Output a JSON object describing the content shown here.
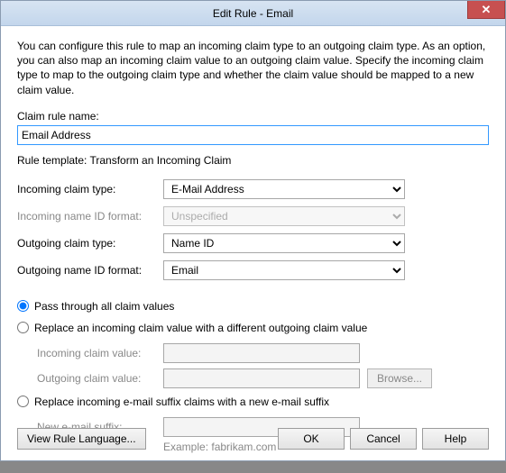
{
  "window": {
    "title": "Edit Rule - Email",
    "close_glyph": "✕"
  },
  "intro": "You can configure this rule to map an incoming claim type to an outgoing claim type. As an option, you can also map an incoming claim value to an outgoing claim value. Specify the incoming claim type to map to the outgoing claim type and whether the claim value should be mapped to a new claim value.",
  "labels": {
    "claim_rule_name": "Claim rule name:",
    "rule_template": "Rule template: Transform an Incoming Claim",
    "incoming_claim_type": "Incoming claim type:",
    "incoming_name_id_format": "Incoming name ID format:",
    "outgoing_claim_type": "Outgoing claim type:",
    "outgoing_name_id_format": "Outgoing name ID format:",
    "incoming_claim_value": "Incoming claim value:",
    "outgoing_claim_value": "Outgoing claim value:",
    "new_email_suffix": "New e-mail suffix:",
    "example_text": "Example: fabrikam.com"
  },
  "values": {
    "claim_rule_name": "Email Address",
    "incoming_claim_type": "E-Mail Address",
    "incoming_name_id_format": "Unspecified",
    "outgoing_claim_type": "Name ID",
    "outgoing_name_id_format": "Email",
    "incoming_claim_value": "",
    "outgoing_claim_value": "",
    "new_email_suffix": ""
  },
  "radios": {
    "pass_through": "Pass through all claim values",
    "replace_value": "Replace an incoming claim value with a different outgoing claim value",
    "replace_suffix": "Replace incoming e-mail suffix claims with a new e-mail suffix",
    "selected": "pass_through"
  },
  "buttons": {
    "browse": "Browse...",
    "view_rule_language": "View Rule Language...",
    "ok": "OK",
    "cancel": "Cancel",
    "help": "Help"
  }
}
